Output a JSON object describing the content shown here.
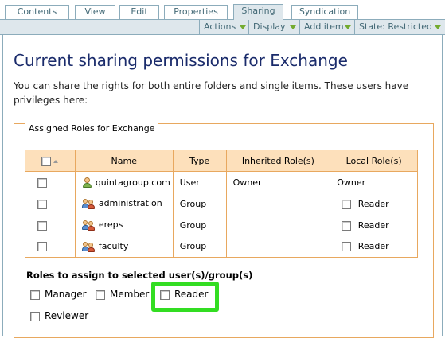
{
  "tabs": [
    {
      "label": "Contents",
      "selected": false
    },
    {
      "label": "View",
      "selected": false
    },
    {
      "label": "Edit",
      "selected": false
    },
    {
      "label": "Properties",
      "selected": false
    },
    {
      "label": "Sharing",
      "selected": true
    },
    {
      "label": "Syndication",
      "selected": false
    }
  ],
  "menus": {
    "actions": "Actions",
    "display": "Display",
    "add_item": "Add item",
    "state": "State: Restricted"
  },
  "page": {
    "title": "Current sharing permissions for Exchange",
    "description": "You can share the rights for both entire folders and single items. These users have privileges here:"
  },
  "roles_fieldset": {
    "legend": "Assigned Roles for Exchange",
    "columns": [
      "Name",
      "Type",
      "Inherited Role(s)",
      "Local Role(s)"
    ],
    "rows": [
      {
        "name": "quintagroup.com",
        "icon": "user-icon",
        "type": "User",
        "inherited": "Owner",
        "local": "Owner",
        "local_checkbox": false
      },
      {
        "name": "administration",
        "icon": "group-icon",
        "type": "Group",
        "inherited": "",
        "local": "Reader",
        "local_checkbox": true
      },
      {
        "name": "ereps",
        "icon": "group-icon",
        "type": "Group",
        "inherited": "",
        "local": "Reader",
        "local_checkbox": true
      },
      {
        "name": "faculty",
        "icon": "group-icon",
        "type": "Group",
        "inherited": "",
        "local": "Reader",
        "local_checkbox": true
      }
    ]
  },
  "assign": {
    "heading": "Roles to assign to selected user(s)/group(s)",
    "options": [
      "Manager",
      "Member",
      "Reader",
      "Reviewer"
    ]
  },
  "colors": {
    "accent": "#436976",
    "menu_arrow": "#73ab2f",
    "table_header": "#fde0bb",
    "table_border": "#e8a85f",
    "highlight": "#33dd22"
  }
}
